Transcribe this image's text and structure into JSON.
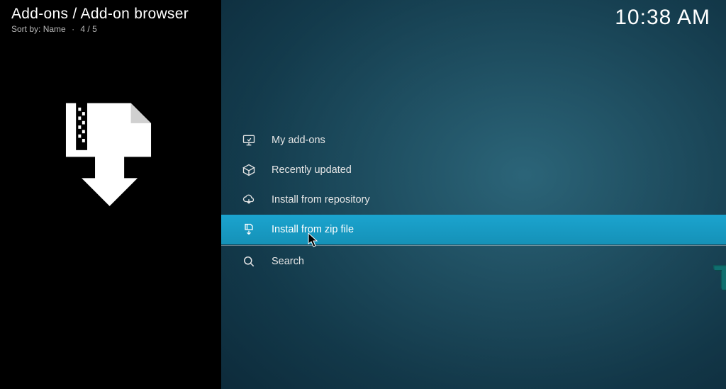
{
  "header": {
    "breadcrumb": "Add-ons / Add-on browser",
    "sort_prefix": "Sort by:",
    "sort_value": "Name",
    "position": "4 / 5"
  },
  "clock": "10:38 AM",
  "menu": {
    "items": [
      {
        "label": "My add-ons",
        "icon": "monitor-icon"
      },
      {
        "label": "Recently updated",
        "icon": "box-open-icon"
      },
      {
        "label": "Install from repository",
        "icon": "cloud-download-icon"
      },
      {
        "label": "Install from zip file",
        "icon": "zip-download-icon",
        "selected": true
      },
      {
        "label": "Search",
        "icon": "search-icon"
      }
    ]
  },
  "watermark": "TECHFOLLOWS"
}
